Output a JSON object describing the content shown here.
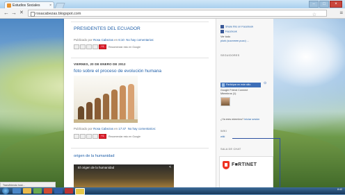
{
  "browser": {
    "tab_title": "Estudios Sociales",
    "tab_close": "×",
    "url": "rosacabezas.blogspot.com",
    "back": "←",
    "forward": "→",
    "reload": "✕",
    "star": "☆",
    "menu": "≡",
    "window_buttons": {
      "minimize": "–",
      "maximize": "□",
      "close": "×"
    }
  },
  "post1": {
    "title": "PRESIDENTES DEL ECUADOR",
    "published_prefix": "Publicado por",
    "author": "Rosa Cabezas",
    "at": "en",
    "time": "6:10",
    "comments": "No hay comentarios:",
    "recommend": "Recomendar esto en Google"
  },
  "date_header": "VIERNES, 20 DE ENERO DE 2012",
  "post2": {
    "title": "foto sobre el proceso de evolución humana",
    "published_prefix": "Publicado por",
    "author": "Rosa Cabezas",
    "at": "en",
    "time": "17:47",
    "comments": "No hay comentarios:",
    "recommend": "Recomendar esto en Google"
  },
  "post3": {
    "title": "origen de la humanidad",
    "video_title": "El origen de la humanidad",
    "video_share": "<"
  },
  "sidebar": {
    "share_facebook": "Share this on Facebook",
    "facebook": "Facebook",
    "ver_todo": "Ver todo",
    "url_short": "plurk (soonmee.puzo) ...",
    "seguidores": "SEGUIDORES",
    "participar": "Participar en este sitio",
    "gfc": "Google Friend Connect",
    "miembros": "Miembros (1)",
    "already_member": "¿Ya eres miembro?",
    "login": "Iniciar sesión",
    "wiki": "WIKI",
    "wiki_link": "wiki",
    "sala_chat": "SALA DE CHAT",
    "fortinet": "F■RTINET"
  },
  "status_text": "Transfiriendo host...",
  "taskbar": {
    "clock": "8:42"
  },
  "colors": {
    "link": "#1e5ea8",
    "fortinet_red": "#e32",
    "taskbar": "#16375a"
  }
}
